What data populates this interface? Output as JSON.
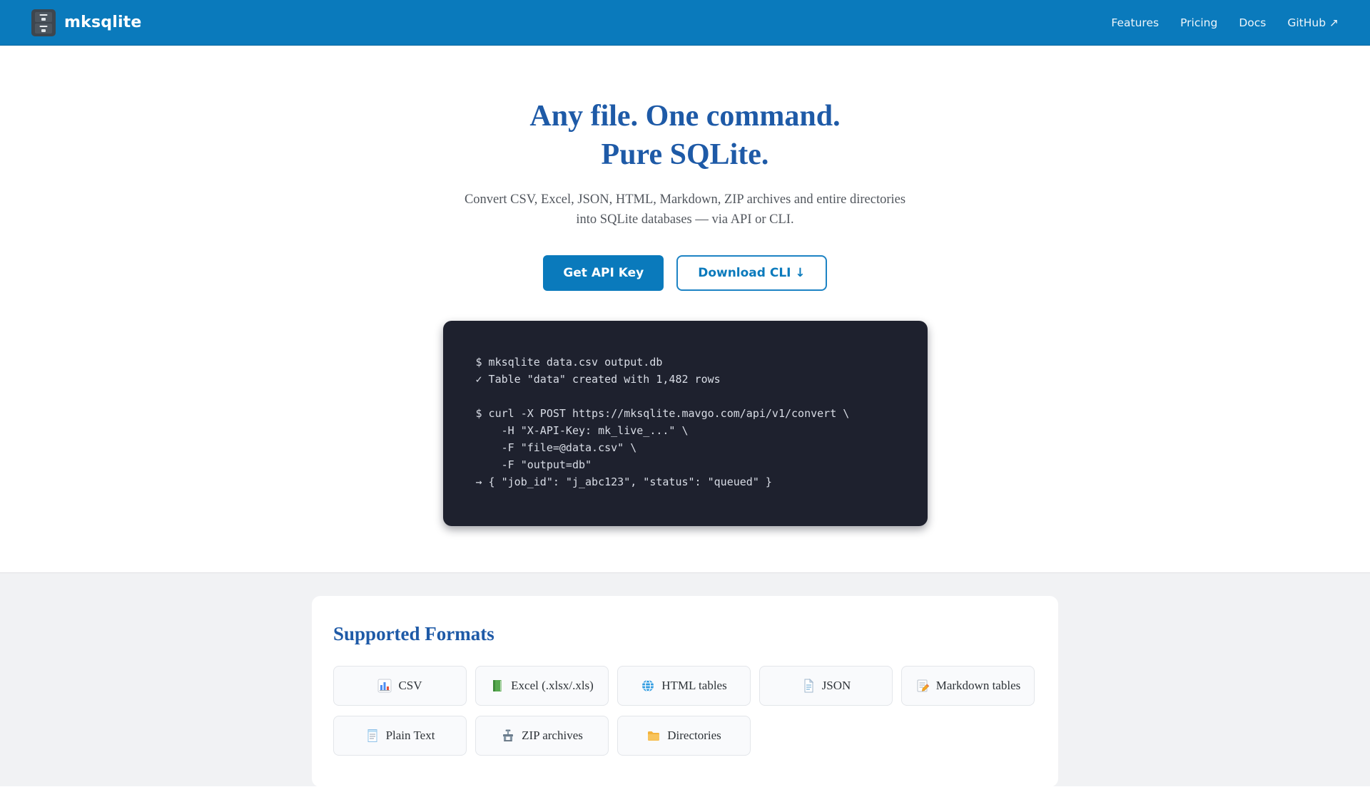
{
  "nav": {
    "brand": "mksqlite",
    "links": [
      {
        "label": "Features"
      },
      {
        "label": "Pricing"
      },
      {
        "label": "Docs"
      },
      {
        "label": "GitHub ↗"
      }
    ]
  },
  "hero": {
    "title_line1": "Any file. One command.",
    "title_line2": "Pure SQLite.",
    "subtitle_line1": "Convert CSV, Excel, JSON, HTML, Markdown, ZIP archives and entire directories",
    "subtitle_line2": "into SQLite databases — via API or CLI.",
    "primary_button": "Get API Key",
    "secondary_button": "Download CLI ↓"
  },
  "terminal": {
    "lines": [
      "$ mksqlite data.csv output.db",
      "✓ Table \"data\" created with 1,482 rows",
      "",
      "$ curl -X POST https://mksqlite.mavgo.com/api/v1/convert \\",
      "    -H \"X-API-Key: mk_live_...\" \\",
      "    -F \"file=@data.csv\" \\",
      "    -F \"output=db\"",
      "→ { \"job_id\": \"j_abc123\", \"status\": \"queued\" }"
    ]
  },
  "formats": {
    "heading": "Supported Formats",
    "items": [
      {
        "icon": "bar-chart-icon",
        "label": "CSV"
      },
      {
        "icon": "green-book-icon",
        "label": "Excel (.xlsx/.xls)"
      },
      {
        "icon": "globe-icon",
        "label": "HTML tables"
      },
      {
        "icon": "page-icon",
        "label": "JSON"
      },
      {
        "icon": "memo-pencil-icon",
        "label": "Markdown tables"
      },
      {
        "icon": "page-lines-icon",
        "label": "Plain Text"
      },
      {
        "icon": "clamp-icon",
        "label": "ZIP archives"
      },
      {
        "icon": "folder-icon",
        "label": "Directories"
      }
    ]
  },
  "colors": {
    "brand_blue": "#0a7abc",
    "heading_blue": "#1e5aa7",
    "terminal_bg": "#1e212e",
    "terminal_text": "#d9dde6",
    "section_bg": "#f1f2f4"
  }
}
